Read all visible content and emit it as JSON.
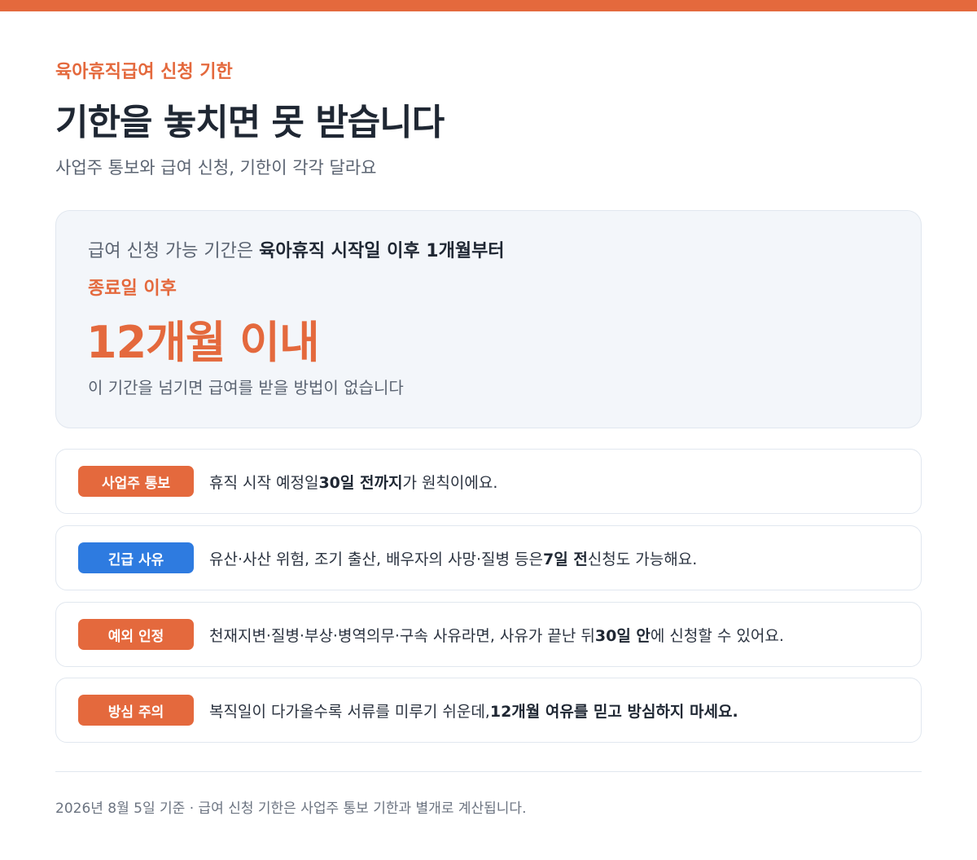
{
  "header": {
    "eyebrow": "육아휴직급여 신청 기한",
    "title": "기한을 놓치면 못 받습니다",
    "subtitle": "사업주 통보와 급여 신청, 기한이 각각 달라요"
  },
  "hero": {
    "line1_prefix": "급여 신청 가능 기간은 ",
    "line1_bold": "육아휴직 시작일 이후 1개월부터",
    "line2": "종료일 이후",
    "big": "12개월 이내",
    "note": "이 기간을 넘기면 급여를 받을 방법이 없습니다"
  },
  "rows": [
    {
      "badge": "사업주 통보",
      "badge_color": "#e4693d",
      "pre": "휴직 시작 예정일 ",
      "bold": "30일 전까지",
      "post": "가 원칙이에요."
    },
    {
      "badge": "긴급 사유",
      "badge_color": "#2e7be0",
      "pre": "유산·사산 위험, 조기 출산, 배우자의 사망·질병 등은 ",
      "bold": "7일 전",
      "post": " 신청도 가능해요."
    },
    {
      "badge": "예외 인정",
      "badge_color": "#e4693d",
      "pre": "천재지변·질병·부상·병역의무·구속 사유라면, 사유가 끝난 뒤 ",
      "bold": "30일 안",
      "post": "에 신청할 수 있어요."
    },
    {
      "badge": "방심 주의",
      "badge_color": "#e4693d",
      "pre": "복직일이 다가올수록 서류를 미루기 쉬운데, ",
      "bold": "12개월 여유를 믿고 방심하지 마세요.",
      "post": ""
    }
  ],
  "footer": "2026년 8월 5일 기준 · 급여 신청 기한은 사업주 통보 기한과 별개로 계산됩니다.",
  "colors": {
    "accent": "#e4693d",
    "urgent": "#2e7be0"
  }
}
